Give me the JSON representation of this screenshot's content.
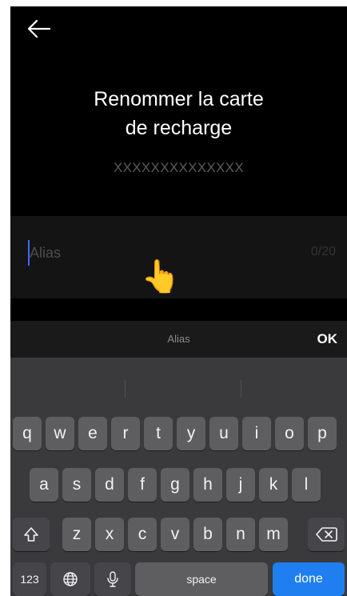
{
  "header": {
    "title_line1": "Renommer la carte",
    "title_line2": "de recharge",
    "card_number": "XXXXXXXXXXXXXX"
  },
  "field": {
    "placeholder": "Alias",
    "value": "",
    "counter": "0/20"
  },
  "accessory_bar": {
    "label": "Alias",
    "ok_label": "OK"
  },
  "keyboard": {
    "row1": [
      "q",
      "w",
      "e",
      "r",
      "t",
      "y",
      "u",
      "i",
      "o",
      "p"
    ],
    "row2": [
      "a",
      "s",
      "d",
      "f",
      "g",
      "h",
      "j",
      "k",
      "l"
    ],
    "row3": [
      "z",
      "x",
      "c",
      "v",
      "b",
      "n",
      "m"
    ],
    "numbers_label": "123",
    "space_label": "space",
    "done_label": "done"
  },
  "icons": {
    "back": "arrow-left-icon",
    "shift": "shift-icon",
    "delete": "backspace-icon",
    "globe": "globe-icon",
    "mic": "microphone-icon",
    "pointer": "pointing-hand-icon"
  },
  "colors": {
    "background": "#000000",
    "accent": "#1f7ff0",
    "caret": "#3b6cf5"
  }
}
